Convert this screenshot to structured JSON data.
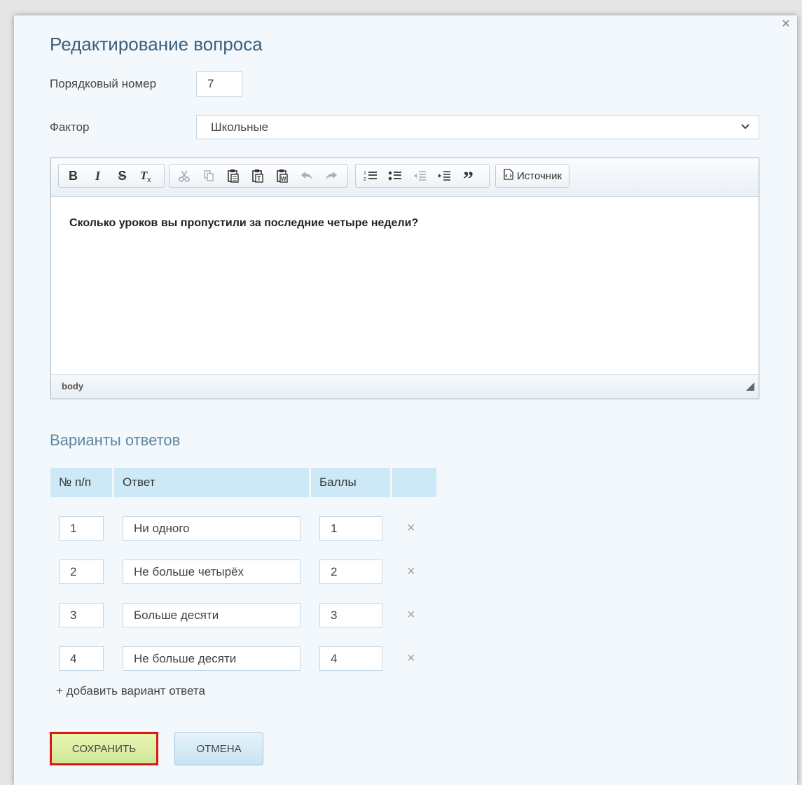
{
  "dialog": {
    "title": "Редактирование вопроса",
    "close_label": "×"
  },
  "fields": {
    "order_label": "Порядковый номер",
    "order_value": "7",
    "factor_label": "Фактор",
    "factor_value": "Школьные"
  },
  "editor": {
    "toolbar": {
      "bold": "B",
      "italic": "I",
      "strike": "S",
      "remove_format": "Tx",
      "source_label": "Источник"
    },
    "icons": [
      "bold-icon",
      "italic-icon",
      "strikethrough-icon",
      "remove-format-icon",
      "cut-icon",
      "copy-icon",
      "paste-icon",
      "paste-text-icon",
      "paste-word-icon",
      "undo-icon",
      "redo-icon",
      "numbered-list-icon",
      "bulleted-list-icon",
      "outdent-icon",
      "indent-icon",
      "blockquote-icon",
      "source-icon"
    ],
    "content": "Сколько уроков вы пропустили за последние четыре недели?",
    "status_path": "body"
  },
  "answers": {
    "section_title": "Варианты ответов",
    "headers": {
      "num": "№ п/п",
      "answer": "Ответ",
      "points": "Баллы"
    },
    "rows": [
      {
        "num": "1",
        "answer": "Ни одного",
        "points": "1"
      },
      {
        "num": "2",
        "answer": "Не больше четырёх",
        "points": "2"
      },
      {
        "num": "3",
        "answer": "Больше десяти",
        "points": "3"
      },
      {
        "num": "4",
        "answer": "Не больше десяти",
        "points": "4"
      }
    ],
    "remove_label": "×",
    "add_label": "+  добавить вариант ответа"
  },
  "buttons": {
    "save": "СОХРАНИТЬ",
    "cancel": "ОТМЕНА"
  },
  "colors": {
    "accent_title": "#3a5f7d",
    "section_title": "#5d87a6",
    "table_header": "#cde9f8",
    "save_bg": "#dbefa5",
    "save_border": "#e01515",
    "cancel_bg": "#d3eaf7"
  }
}
